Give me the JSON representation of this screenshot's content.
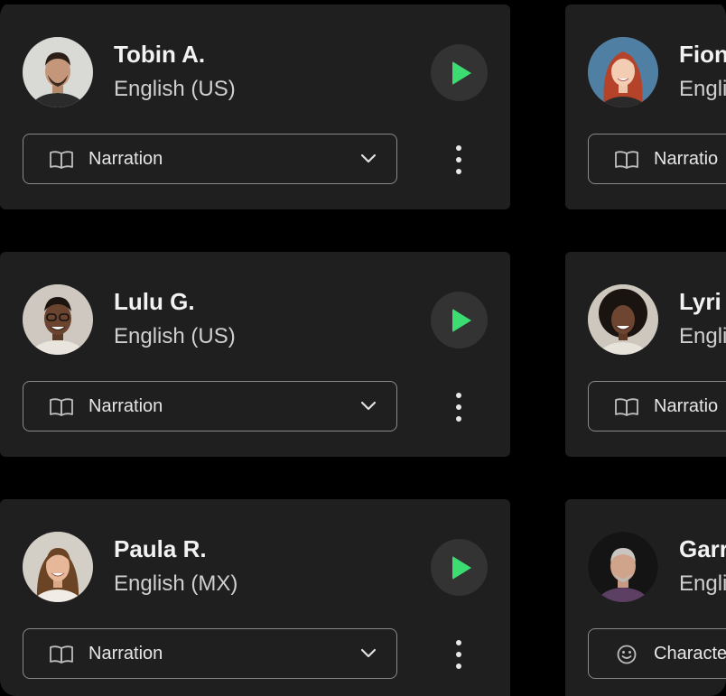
{
  "voices": [
    {
      "name": "Tobin A.",
      "language": "English (US)",
      "category": "Narration",
      "category_icon": "book-icon"
    },
    {
      "name": "Lulu G.",
      "language": "English (US)",
      "category": "Narration",
      "category_icon": "book-icon"
    },
    {
      "name": "Paula R.",
      "language": "English (MX)",
      "category": "Narration",
      "category_icon": "book-icon"
    },
    {
      "name": "Fion",
      "language": "Engli",
      "category": "Narratio",
      "category_icon": "book-icon"
    },
    {
      "name": "Lyri",
      "language": "Engli",
      "category": "Narratio",
      "category_icon": "book-icon"
    },
    {
      "name": "Garr",
      "language": "Engli",
      "category": "Characte",
      "category_icon": "smile-icon"
    }
  ],
  "colors": {
    "background": "#000000",
    "card": "#1f1f1f",
    "play_accent": "#3ddc72",
    "play_bg": "#333333",
    "text_primary": "#f2f2f2",
    "text_secondary": "#cfcfcf",
    "border": "#8a8a8a"
  }
}
